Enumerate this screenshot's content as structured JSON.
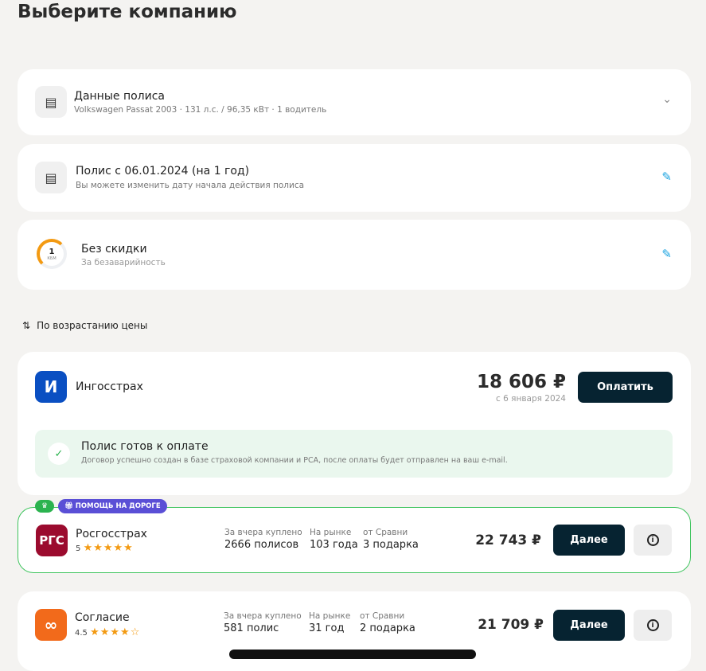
{
  "title": "Выберите компанию",
  "policy_data": {
    "title": "Данные полиса",
    "car": "Volkswagen Passat 2003",
    "power": "131 л.с. / 96,35 кВт",
    "drivers": "1 водитель"
  },
  "policy_date": {
    "title": "Полис с 06.01.2024 (на 1 год)",
    "subtitle": "Вы можете изменить дату начала действия полиса"
  },
  "discount": {
    "kbm_value": "1",
    "kbm_label": "КБМ",
    "title": "Без скидки",
    "subtitle": "За безаварийность"
  },
  "sort": {
    "label": "По возрастанию цены"
  },
  "offers": [
    {
      "name": "Ингосстрах",
      "logo": "И",
      "price": "18 606 ₽",
      "date": "с 6 января 2024",
      "button": "Оплатить",
      "status_title": "Полис готов к оплате",
      "status_text": "Договор успешно создан в базе страховой компании и РСА, после оплаты будет отправлен на ваш e-mail.",
      "color": "#0a4fc2"
    },
    {
      "name": "Росгосстрах",
      "logo": "РГС",
      "rating": "5",
      "stars": "★★★★★",
      "badge": "ПОМОЩЬ НА ДОРОГЕ",
      "stats": [
        {
          "label": "За вчера куплено",
          "value": "2666 полисов"
        },
        {
          "label": "На рынке",
          "value": "103 года"
        },
        {
          "label": "от Сравни",
          "value": "3 подарка"
        }
      ],
      "price": "22 743 ₽",
      "button": "Далее",
      "color": "#9b0b2e"
    },
    {
      "name": "Согласие",
      "logo": "∞",
      "rating": "4.5",
      "stars": "★★★★☆",
      "stats": [
        {
          "label": "За вчера куплено",
          "value": "581 полис"
        },
        {
          "label": "На рынке",
          "value": "31 год"
        },
        {
          "label": "от Сравни",
          "value": "2 подарка"
        }
      ],
      "price": "21 709 ₽",
      "button": "Далее",
      "color": "#f26a1b"
    }
  ]
}
